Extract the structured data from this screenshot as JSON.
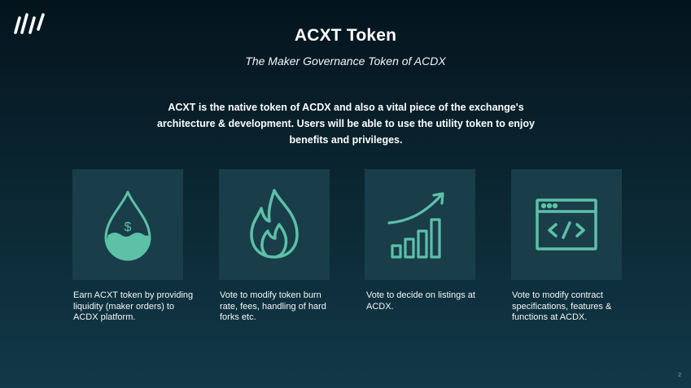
{
  "slide": {
    "title": "ACXT Token",
    "subtitle": "The Maker Governance Token of ACDX",
    "intro": "ACXT is the native token of ACDX and also a vital piece of the exchange's architecture & development. Users will be able to use the utility token to enjoy benefits and privileges.",
    "page_number": "2"
  },
  "cards": [
    {
      "icon": "liquidity-drop-icon",
      "caption": "Earn ACXT token by providing liquidity (maker orders) to ACDX platform."
    },
    {
      "icon": "flame-icon",
      "caption": "Vote to modify token burn rate, fees, handling of hard forks etc."
    },
    {
      "icon": "growth-chart-icon",
      "caption": "Vote to decide on listings at ACDX."
    },
    {
      "icon": "code-window-icon",
      "caption": "Vote to modify contract specifications, features & functions at ACDX."
    }
  ],
  "colors": {
    "icon_stroke": "#5cc1a7",
    "card_background": "#1a3d4a"
  }
}
